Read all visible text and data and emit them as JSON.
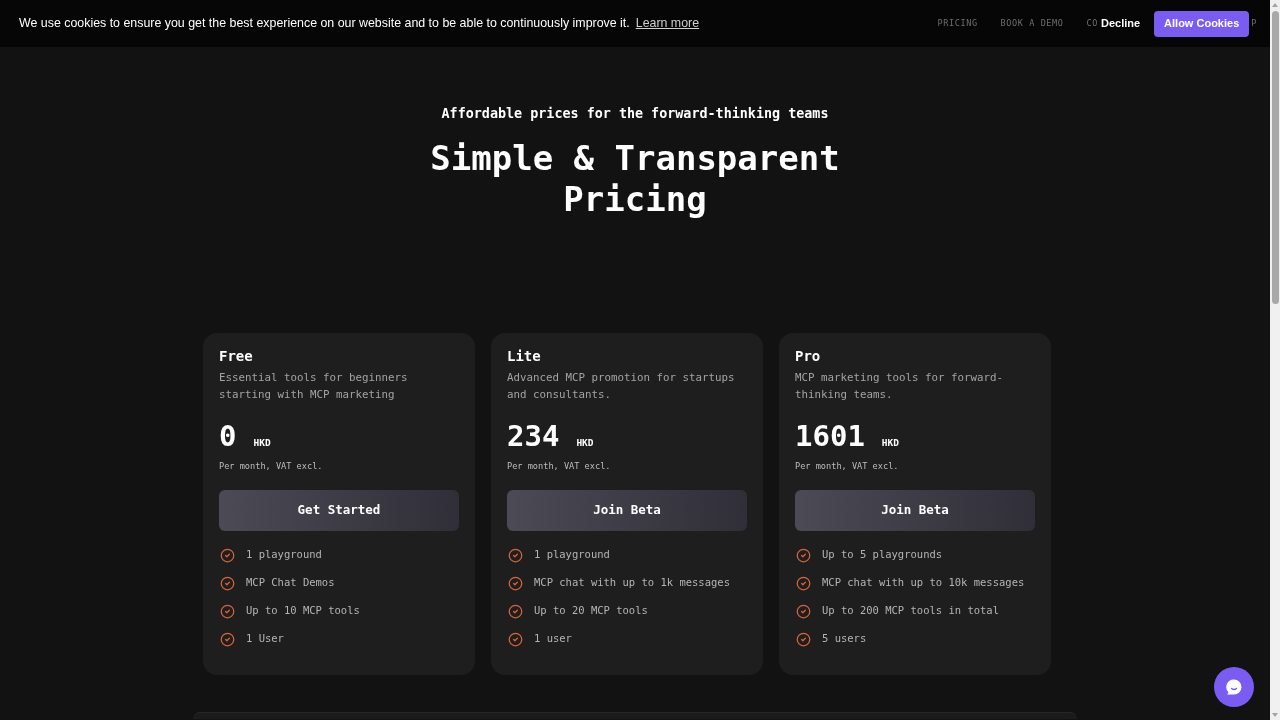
{
  "cookie_banner": {
    "message": "We use cookies to ensure you get the best experience on our website and to be able to continuously improve it.",
    "link": "Learn more"
  },
  "top_bar_right": [
    {
      "kind": "link",
      "label": "PRICING"
    },
    {
      "kind": "link",
      "label": "BOOK A DEMO"
    },
    {
      "kind": "link",
      "label": "CO"
    },
    {
      "kind": "decline",
      "label": "Decline"
    },
    {
      "kind": "accept",
      "label": "Allow Cookies"
    },
    {
      "kind": "link",
      "label": "P"
    }
  ],
  "hero": {
    "tagline": "Affordable prices for the forward-thinking teams",
    "title": "Simple & Transparent Pricing"
  },
  "plans": [
    {
      "name": "Free",
      "description": "Essential tools for beginners starting with MCP marketing",
      "price": "0",
      "currency": "HKD",
      "billing_note": "Per month, VAT excl.",
      "button": "Get Started",
      "features": [
        "1 playground",
        "MCP Chat Demos",
        "Up to 10 MCP tools",
        "1 User"
      ]
    },
    {
      "name": "Lite",
      "description": "Advanced MCP promotion for startups and consultants.",
      "price": "234",
      "currency": "HKD",
      "billing_note": "Per month, VAT excl.",
      "button": "Join Beta",
      "features": [
        "1 playground",
        "MCP chat with up to 1k messages",
        "Up to 20 MCP tools",
        "1 user"
      ]
    },
    {
      "name": "Pro",
      "description": "MCP marketing tools for forward-thinking teams.",
      "price": "1601",
      "currency": "HKD",
      "billing_note": "Per month, VAT excl.",
      "button": "Join Beta",
      "features": [
        "Up to 5 playgrounds",
        "MCP chat with up to 10k messages",
        "Up to 200 MCP tools in total",
        "5 users"
      ]
    }
  ]
}
